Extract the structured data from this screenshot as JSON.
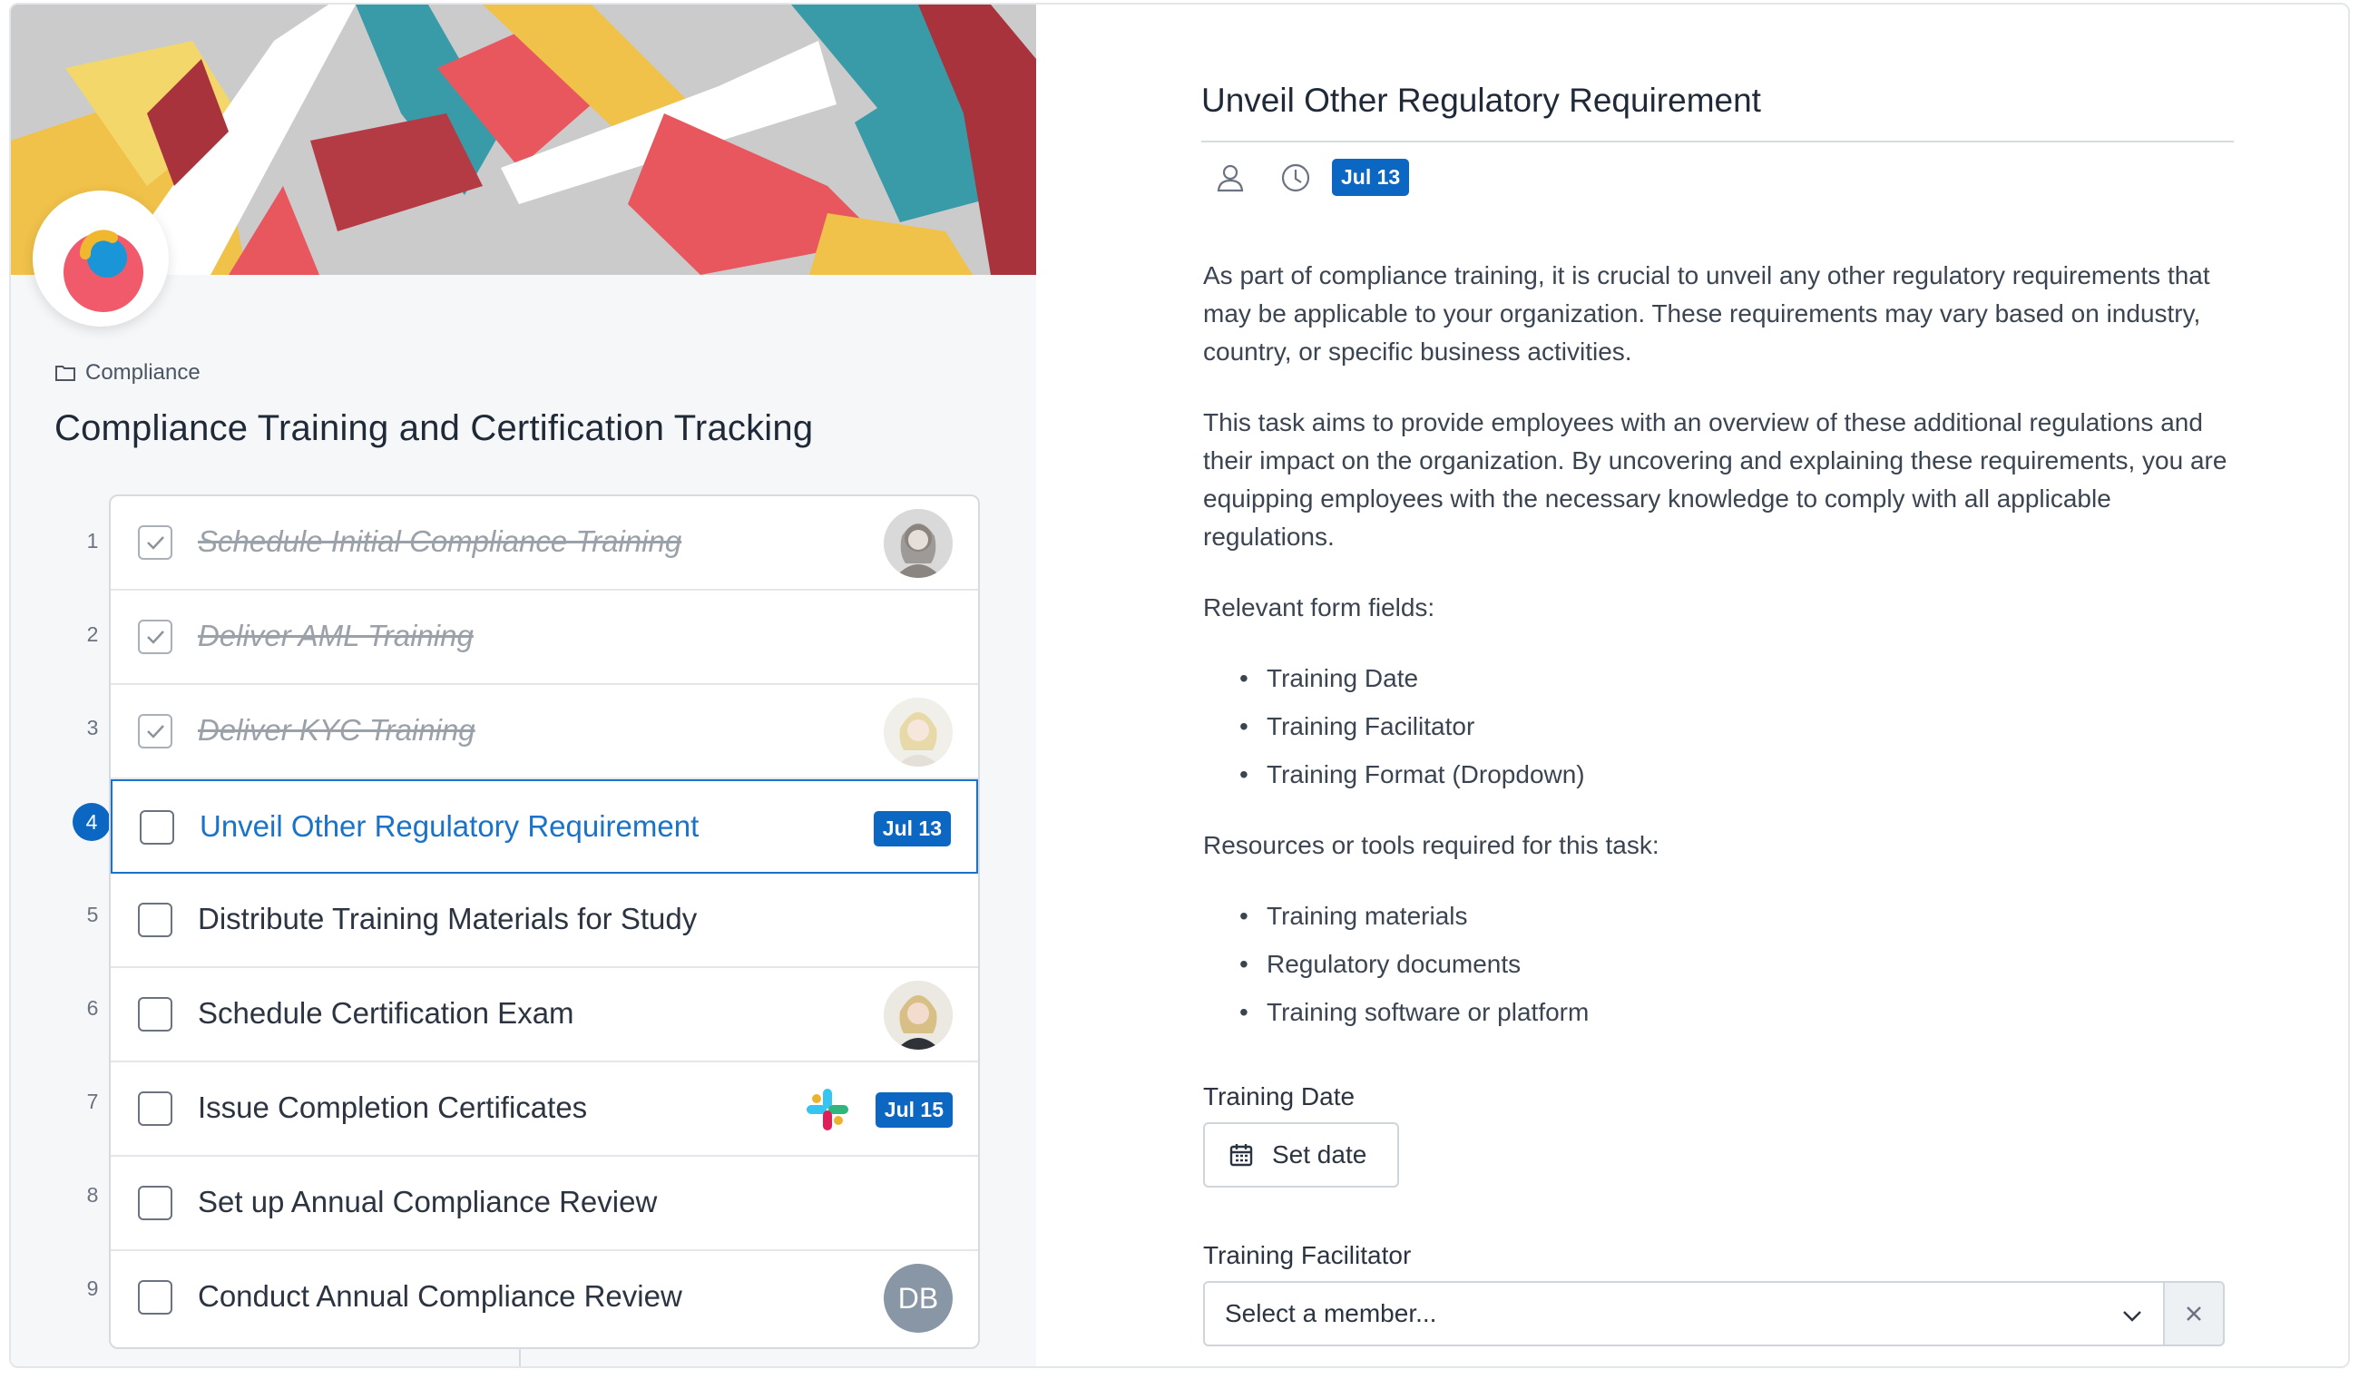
{
  "project": {
    "folder": "Compliance",
    "title": "Compliance Training and Certification Tracking"
  },
  "tasks": [
    {
      "num": "1",
      "label": "Schedule Initial Compliance Training",
      "done": true,
      "avatar": "woman-gray"
    },
    {
      "num": "2",
      "label": "Deliver AML Training",
      "done": true
    },
    {
      "num": "3",
      "label": "Deliver KYC Training",
      "done": true,
      "avatar": "woman-blonde"
    },
    {
      "num": "4",
      "label": "Unveil Other Regulatory Requirement",
      "done": false,
      "active": true,
      "badge": "Jul 13"
    },
    {
      "num": "5",
      "label": "Distribute Training Materials for Study",
      "done": false
    },
    {
      "num": "6",
      "label": "Schedule Certification Exam",
      "done": false,
      "avatar": "woman-blonde"
    },
    {
      "num": "7",
      "label": "Issue Completion Certificates",
      "done": false,
      "badge": "Jul 15",
      "icon": "slack-icon"
    },
    {
      "num": "8",
      "label": "Set up Annual Compliance Review",
      "done": false
    },
    {
      "num": "9",
      "label": "Conduct Annual Compliance Review",
      "done": false,
      "initials": "DB"
    }
  ],
  "detail": {
    "title": "Unveil Other Regulatory Requirement",
    "due_badge": "Jul 13",
    "para1": "As part of compliance training, it is crucial to unveil any other regulatory requirements that may be applicable to your organization. These requirements may vary based on industry, country, or specific business activities.",
    "para2": "This task aims to provide employees with an overview of these additional regulations and their impact on the organization. By uncovering and explaining these requirements, you are equipping employees with the necessary knowledge to comply with all applicable regulations.",
    "form_fields_heading": "Relevant form fields:",
    "form_fields": [
      "Training Date",
      "Training Facilitator",
      "Training Format (Dropdown)"
    ],
    "resources_heading": "Resources or tools required for this task:",
    "resources": [
      "Training materials",
      "Regulatory documents",
      "Training software or platform"
    ],
    "training_date_label": "Training Date",
    "set_date": "Set date",
    "facilitator_label": "Training Facilitator",
    "facilitator_placeholder": "Select a member..."
  },
  "colors": {
    "accent": "#0b67c2",
    "active_text": "#1a73c8"
  }
}
